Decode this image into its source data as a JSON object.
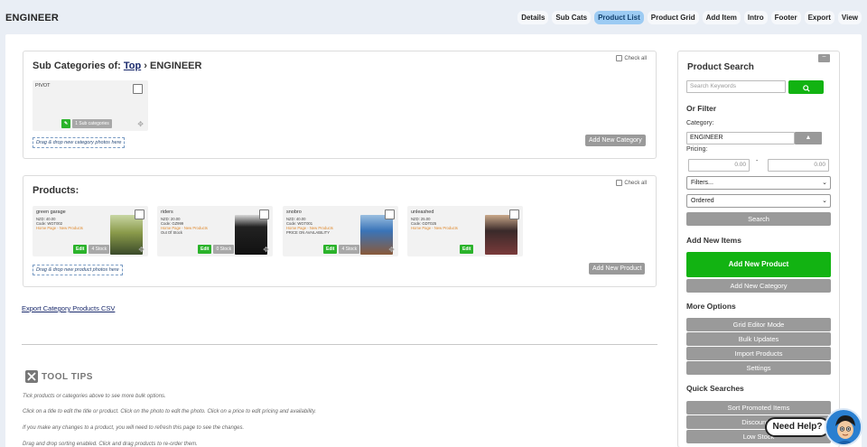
{
  "app": {
    "title": "ENGINEER"
  },
  "nav": [
    {
      "label": "Details",
      "active": false
    },
    {
      "label": "Sub Cats",
      "active": false
    },
    {
      "label": "Product List",
      "active": true
    },
    {
      "label": "Product Grid",
      "active": false
    },
    {
      "label": "Add Item",
      "active": false
    },
    {
      "label": "Intro",
      "active": false
    },
    {
      "label": "Footer",
      "active": false
    },
    {
      "label": "Export",
      "active": false
    },
    {
      "label": "View",
      "active": false
    }
  ],
  "subcats": {
    "title_prefix": "Sub Categories of:",
    "top_link": "Top",
    "separator": "›",
    "current": "ENGINEER",
    "check_all": "Check all",
    "tile": {
      "label": "PIVOT",
      "badge": "1 Sub categories"
    },
    "dropzone": "Drag & drop new category photos here",
    "add_button": "Add New Category"
  },
  "products": {
    "title": "Products:",
    "check_all": "Check all",
    "items": [
      {
        "name": "green garage",
        "price": "NZD: 40.00",
        "code": "Code: WGT002",
        "pages": "Home Page - New Products",
        "status": "",
        "edit": "Edit",
        "stock": "4 Stock"
      },
      {
        "name": "riders",
        "price": "NZD: 20.00",
        "code": "Code: GZ999",
        "pages": "Home Page - New Products",
        "status": "Out Of Stock",
        "edit": "Edit",
        "stock": "0 Stock"
      },
      {
        "name": "snobro",
        "price": "NZD: 40.00",
        "code": "Code: WGT001",
        "pages": "Home Page - New Products",
        "status": "PRICE ON AVAILABILITY",
        "edit": "Edit",
        "stock": "4 Stock"
      },
      {
        "name": "unleashed",
        "price": "NZD: 25.00",
        "code": "Code: GDT025",
        "pages": "Home Page - New Products",
        "status": "",
        "edit": "Edit",
        "stock": ""
      }
    ],
    "dropzone": "Drag & drop new product photos here",
    "add_button": "Add New Product"
  },
  "export_link": "Export Category Products CSV",
  "tooltips": {
    "title": "TOOL TIPS",
    "lines": [
      "Tick products or categories above to see more bulk options.",
      "Click on a title to edit the title or product. Click on the photo to edit the photo. Click on a price to edit pricing and availability.",
      "If you make any changes to a product, you will need to refresh this page to see the changes.",
      "Drag and drop sorting enabled. Click and drag products to re-order them."
    ]
  },
  "sidebar": {
    "title": "Product Search",
    "min_label": "–",
    "search_placeholder": "Search Keywords",
    "or_filter": "Or Filter",
    "category_label": "Category:",
    "category_value": "ENGINEER",
    "pricing_label": "Pricing:",
    "price_min": "0.00",
    "price_sep": "-",
    "price_max": "0.00",
    "filters_select": "Filters...",
    "order_select": "Ordered",
    "search_button": "Search",
    "add_new_items": "Add New Items",
    "add_product_button": "Add New Product",
    "add_category_button": "Add New Category",
    "more_options": "More Options",
    "options": [
      "Grid Editor Mode",
      "Bulk Updates",
      "Import Products",
      "Settings"
    ],
    "quick_searches": "Quick Searches",
    "quick": [
      "Sort Promoted Items",
      "Discounted",
      "Low Stock"
    ]
  },
  "help": {
    "label": "Need Help?"
  },
  "colors": {
    "accent_green": "#12b312",
    "nav_active": "#9ccbf3",
    "link": "#1a2a6c"
  }
}
